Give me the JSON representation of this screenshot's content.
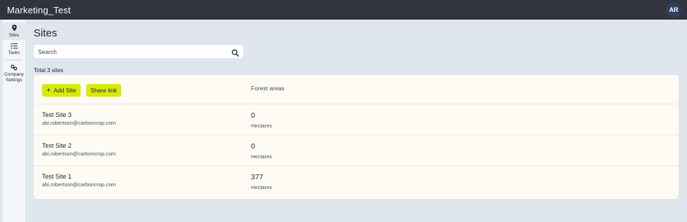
{
  "topbar": {
    "title": "Marketing_Test",
    "avatar_initials": "AR"
  },
  "sidebar": {
    "items": [
      {
        "label": "Sites",
        "icon": "map-pin-icon"
      },
      {
        "label": "Tasks",
        "icon": "task-list-icon"
      },
      {
        "label": "Company Settings",
        "icon": "gears-icon"
      }
    ]
  },
  "page": {
    "title": "Sites",
    "search_placeholder": "Search",
    "total_label": "Total 3 sites"
  },
  "card": {
    "add_label": "Add Site",
    "share_label": "Share link",
    "column_header": "Forest areas",
    "rows": [
      {
        "name": "Test Site 3",
        "email": "abi.robertson@carboncrop.com",
        "value": "0",
        "unit": "Hectares"
      },
      {
        "name": "Test Site 2",
        "email": "abi.robertson@carboncrop.com",
        "value": "0",
        "unit": "Hectares"
      },
      {
        "name": "Test Site 1",
        "email": "abi.robertson@carboncrop.com",
        "value": "377",
        "unit": "Hectares"
      }
    ]
  },
  "colors": {
    "topbar": "#31333e",
    "accent": "#d7ea0c",
    "background": "#e0e6ee",
    "card": "#fdfbf4",
    "avatar": "#2e3f63"
  }
}
